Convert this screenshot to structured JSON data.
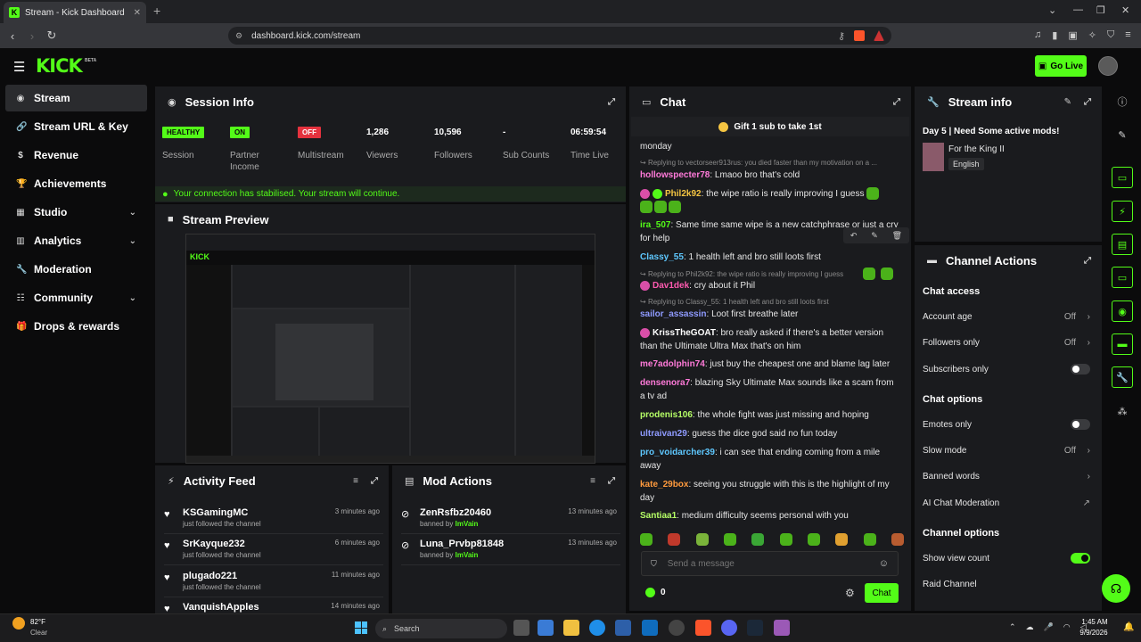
{
  "browser": {
    "tab_title": "Stream - Kick Dashboard",
    "url": "dashboard.kick.com/stream"
  },
  "header": {
    "logo": "KICK",
    "beta": "BETA",
    "go_live": "Go Live"
  },
  "sidebar": {
    "items": [
      {
        "label": "Stream",
        "icon": "radio-icon",
        "active": true
      },
      {
        "label": "Stream URL & Key",
        "icon": "link-icon"
      },
      {
        "label": "Revenue",
        "icon": "dollar-icon"
      },
      {
        "label": "Achievements",
        "icon": "trophy-icon"
      },
      {
        "label": "Studio",
        "icon": "studio-icon",
        "chevron": true
      },
      {
        "label": "Analytics",
        "icon": "chart-icon",
        "chevron": true
      },
      {
        "label": "Moderation",
        "icon": "wrench-icon"
      },
      {
        "label": "Community",
        "icon": "people-icon",
        "chevron": true
      },
      {
        "label": "Drops & rewards",
        "icon": "gift-icon"
      }
    ]
  },
  "session": {
    "title": "Session Info",
    "stats": [
      {
        "badge": "HEALTHY",
        "label": "Session",
        "color": "#53fc18"
      },
      {
        "badge": "ON",
        "label": "Partner Income",
        "color": "#53fc18"
      },
      {
        "badge": "OFF",
        "label": "Multistream",
        "color": "#e5323e"
      },
      {
        "value": "1,286",
        "label": "Viewers"
      },
      {
        "value": "10,596",
        "label": "Followers"
      },
      {
        "value": "-",
        "label": "Sub Counts"
      },
      {
        "value": "06:59:54",
        "label": "Time Live"
      }
    ],
    "connection": "Your connection has stabilised. Your stream will continue."
  },
  "preview": {
    "title": "Stream Preview"
  },
  "activity": {
    "title": "Activity Feed",
    "items": [
      {
        "name": "KSGamingMC",
        "sub": "just followed the channel",
        "time": "3 minutes ago"
      },
      {
        "name": "SrKayque232",
        "sub": "just followed the channel",
        "time": "6 minutes ago"
      },
      {
        "name": "plugado221",
        "sub": "just followed the channel",
        "time": "11 minutes ago"
      },
      {
        "name": "VanquishApples",
        "sub": "",
        "time": "14 minutes ago"
      }
    ]
  },
  "mod": {
    "title": "Mod Actions",
    "by_prefix": "banned by",
    "items": [
      {
        "name": "ZenRsfbz20460",
        "by": "ImVain",
        "time": "13 minutes ago"
      },
      {
        "name": "Luna_Prvbp81848",
        "by": "ImVain",
        "time": "13 minutes ago"
      }
    ]
  },
  "chat": {
    "title": "Chat",
    "gift": "Gift 1 sub to take 1st",
    "placeholder": "Send a message",
    "count": "0",
    "send": "Chat",
    "messages": [
      {
        "text": "monday"
      },
      {
        "reply": "Replying to vectorseer913rus: you died faster than my motivation on a ..."
      },
      {
        "user": "hollowspecter78",
        "color": "#ff7ad9",
        "text": "Lmaoo bro that's cold"
      },
      {
        "user": "Phil2k92",
        "color": "#f5c542",
        "text": "the wipe ratio is really improving I guess"
      },
      {
        "user": "ira_507",
        "color": "#53fc18",
        "text": "Same time same wipe is a new catchphrase or just a cry for help"
      },
      {
        "user": "Classy_55",
        "color": "#5ec8ff",
        "text": "1 health left and bro still loots first"
      },
      {
        "reply": "Replying to Phil2k92: the wipe ratio is really improving I guess"
      },
      {
        "user": "Dav1dek",
        "color": "#ff5ab0",
        "text": "cry about it Phil"
      },
      {
        "reply": "Replying to Classy_55: 1 health left and bro still loots first"
      },
      {
        "user": "sailor_assassin",
        "color": "#8f9bff",
        "text": "Loot first breathe later"
      },
      {
        "user": "KrissTheGOAT",
        "color": "#ffffff",
        "text": "bro really asked if there's a better version than the Ultimate Ultra Max that's on him"
      },
      {
        "user": "me7adolphin74",
        "color": "#ff7ad9",
        "text": "just buy the cheapest one and blame lag later"
      },
      {
        "user": "densenora7",
        "color": "#ff7ad9",
        "text": "blazing Sky Ultimate Max sounds like a scam from a tv ad"
      },
      {
        "user": "prodenis106",
        "color": "#b6ff66",
        "text": "the whole fight was just missing and hoping"
      },
      {
        "user": "ultraivan29",
        "color": "#8f9bff",
        "text": "guess the dice god said no fun today"
      },
      {
        "user": "pro_voidarcher39",
        "color": "#5ec8ff",
        "text": "i can see that ending coming from a mile away"
      },
      {
        "user": "kate_29box",
        "color": "#ff9a3d",
        "text": "seeing you struggle with this is the highlight of my day"
      },
      {
        "user": "Santiaa1",
        "color": "#b6ff66",
        "text": "medium difficulty seems personal with you"
      }
    ]
  },
  "stream_info": {
    "title": "Stream info",
    "stream_title": "Day 5 | Need Some active mods!",
    "category": "For the King II",
    "language": "English"
  },
  "channel_actions": {
    "title": "Channel Actions",
    "chat_access": "Chat access",
    "account_age": "Account age",
    "account_age_val": "Off",
    "followers_only": "Followers only",
    "followers_only_val": "Off",
    "subscribers_only": "Subscribers only",
    "chat_options": "Chat options",
    "emotes_only": "Emotes only",
    "slow_mode": "Slow mode",
    "slow_mode_val": "Off",
    "banned_words": "Banned words",
    "ai_mod": "AI Chat Moderation",
    "channel_options": "Channel options",
    "show_view_count": "Show view count",
    "raid_channel": "Raid Channel"
  },
  "taskbar": {
    "weather_temp": "82°F",
    "weather_text": "Clear",
    "search": "Search",
    "time": "1:45 AM",
    "date": "9/9/2026"
  }
}
